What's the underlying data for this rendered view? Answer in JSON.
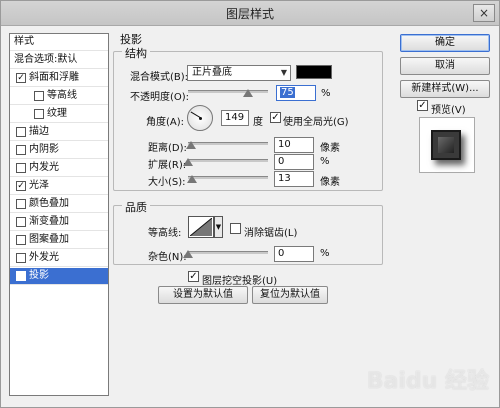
{
  "window": {
    "title": "图层样式",
    "close_glyph": "×"
  },
  "style_list": {
    "header": "样式",
    "blend_options": "混合选项:默认",
    "items": [
      {
        "label": "斜面和浮雕",
        "checked": true,
        "sub": false,
        "selected": false
      },
      {
        "label": "等高线",
        "checked": false,
        "sub": true,
        "selected": false
      },
      {
        "label": "纹理",
        "checked": false,
        "sub": true,
        "selected": false
      },
      {
        "label": "描边",
        "checked": false,
        "sub": false,
        "selected": false
      },
      {
        "label": "内阴影",
        "checked": false,
        "sub": false,
        "selected": false
      },
      {
        "label": "内发光",
        "checked": false,
        "sub": false,
        "selected": false
      },
      {
        "label": "光泽",
        "checked": true,
        "sub": false,
        "selected": false
      },
      {
        "label": "颜色叠加",
        "checked": false,
        "sub": false,
        "selected": false
      },
      {
        "label": "渐变叠加",
        "checked": false,
        "sub": false,
        "selected": false
      },
      {
        "label": "图案叠加",
        "checked": false,
        "sub": false,
        "selected": false
      },
      {
        "label": "外发光",
        "checked": false,
        "sub": false,
        "selected": false
      },
      {
        "label": "投影",
        "checked": true,
        "sub": false,
        "selected": true
      }
    ],
    "check_glyph": "✓"
  },
  "panel": {
    "title": "投影",
    "structure": {
      "title": "结构",
      "blend_mode_label": "混合模式(B):",
      "blend_mode_value": "正片叠底",
      "shadow_color": "#000000",
      "opacity_label": "不透明度(O):",
      "opacity_value": "75",
      "opacity_unit": "%",
      "angle_label": "角度(A):",
      "angle_value": "149",
      "angle_unit": "度",
      "global_light_label": "使用全局光(G)",
      "global_light_checked": true,
      "distance_label": "距离(D):",
      "distance_value": "10",
      "distance_unit": "像素",
      "spread_label": "扩展(R):",
      "spread_value": "0",
      "spread_unit": "%",
      "size_label": "大小(S):",
      "size_value": "13",
      "size_unit": "像素"
    },
    "quality": {
      "title": "品质",
      "contour_label": "等高线:",
      "anti_alias_label": "消除锯齿(L)",
      "anti_alias_checked": false,
      "noise_label": "杂色(N):",
      "noise_value": "0",
      "noise_unit": "%"
    },
    "knockout_label": "图层挖空投影(U)",
    "knockout_checked": true,
    "set_default_button": "设置为默认值",
    "reset_default_button": "复位为默认值"
  },
  "buttons": {
    "ok": "确定",
    "cancel": "取消",
    "new_style": "新建样式(W)...",
    "preview_label": "预览(V)",
    "preview_checked": true
  },
  "watermark": "Baidu 经验"
}
